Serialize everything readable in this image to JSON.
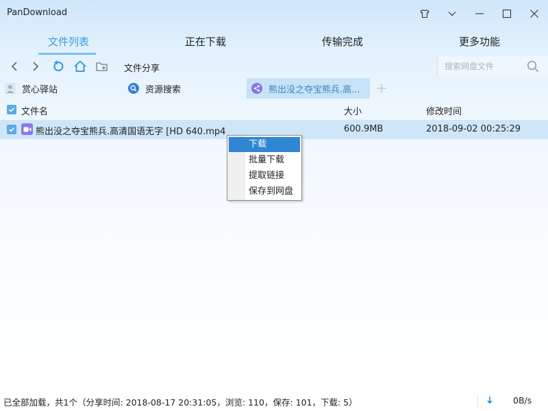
{
  "window": {
    "title": "PanDownload"
  },
  "tabs": [
    {
      "label": "文件列表",
      "active": true
    },
    {
      "label": "正在下载",
      "active": false
    },
    {
      "label": "传输完成",
      "active": false
    },
    {
      "label": "更多功能",
      "active": false
    }
  ],
  "toolbar": {
    "path": "文件分享",
    "search_placeholder": "搜索网盘文件"
  },
  "source_tabs": [
    {
      "label": "赏心驿站",
      "icon": "avatar-icon"
    },
    {
      "label": "资源搜索",
      "icon": "search-icon"
    },
    {
      "label": "熊出没之夺宝熊兵.高...",
      "icon": "share-icon",
      "active": true
    }
  ],
  "list": {
    "columns": [
      "文件名",
      "大小",
      "修改时间"
    ],
    "rows": [
      {
        "name": "熊出没之夺宝熊兵.高清国语无字 [HD 640.mp4",
        "size": "600.9MB",
        "modified": "2018-09-02 00:25:29",
        "checked": true
      }
    ]
  },
  "context_menu": {
    "items": [
      "下载",
      "批量下载",
      "提取链接",
      "保存到网盘"
    ],
    "highlighted": 0
  },
  "status": {
    "text": "已全部加载，共1个（分享时间: 2018-08-17 20:31:05，浏览: 110，保存: 101，下载: 5）",
    "speed": "0B/s"
  },
  "colors": {
    "accent": "#3a9be0",
    "menu_highlight": "#2f86d3",
    "video_icon": "#8a76e8"
  }
}
